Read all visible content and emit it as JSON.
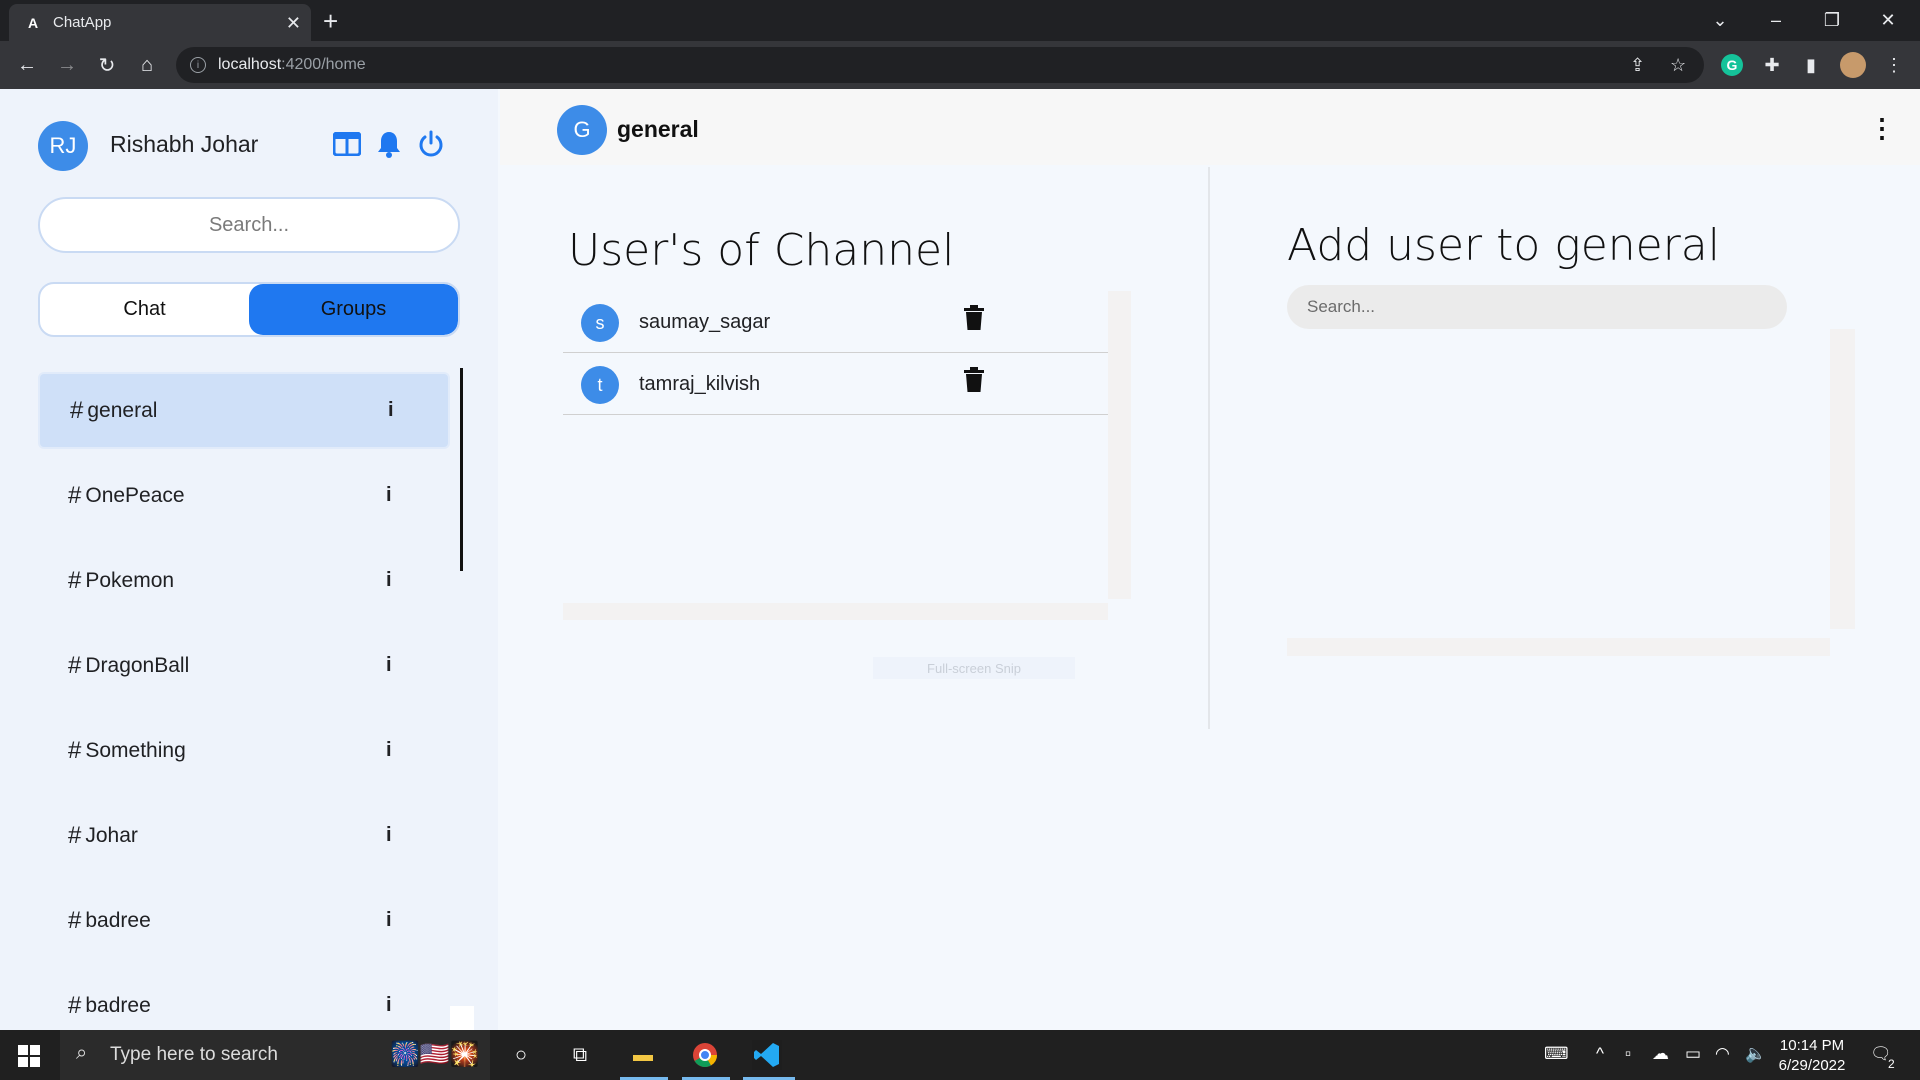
{
  "browser": {
    "tab_title": "ChatApp",
    "url_host": "localhost",
    "url_path": ":4200/home"
  },
  "sidebar": {
    "user_initials": "RJ",
    "user_name": "Rishabh Johar",
    "search_placeholder": "Search...",
    "segments": {
      "chat": "Chat",
      "groups": "Groups",
      "active": "groups"
    },
    "channels": [
      {
        "hash": "#",
        "name": "general",
        "info": "i",
        "selected": true
      },
      {
        "hash": "#",
        "name": "OnePeace",
        "info": "i"
      },
      {
        "hash": "#",
        "name": "Pokemon",
        "info": "i"
      },
      {
        "hash": "#",
        "name": "DragonBall",
        "info": "i"
      },
      {
        "hash": "#",
        "name": "Something",
        "info": "i"
      },
      {
        "hash": "#",
        "name": "Johar",
        "info": "i"
      },
      {
        "hash": "#",
        "name": "badree",
        "info": "i"
      },
      {
        "hash": "#",
        "name": "badree",
        "info": "i"
      }
    ]
  },
  "main": {
    "channel_initial": "G",
    "channel_name": "general",
    "users_title": "User's of Channel",
    "users": [
      {
        "initial": "s",
        "name": "saumay_sagar"
      },
      {
        "initial": "t",
        "name": "tamraj_kilvish"
      }
    ],
    "ghost_text": "Full-screen Snip",
    "add_title": "Add user to general",
    "add_search_placeholder": "Search..."
  },
  "taskbar": {
    "search_placeholder": "Type here to search",
    "time": "10:14 PM",
    "date": "6/29/2022",
    "notification_count": "2"
  },
  "colors": {
    "accent": "#1f78f0",
    "avatar": "#3d8ce8",
    "selected_channel": "#cfe0f8"
  }
}
